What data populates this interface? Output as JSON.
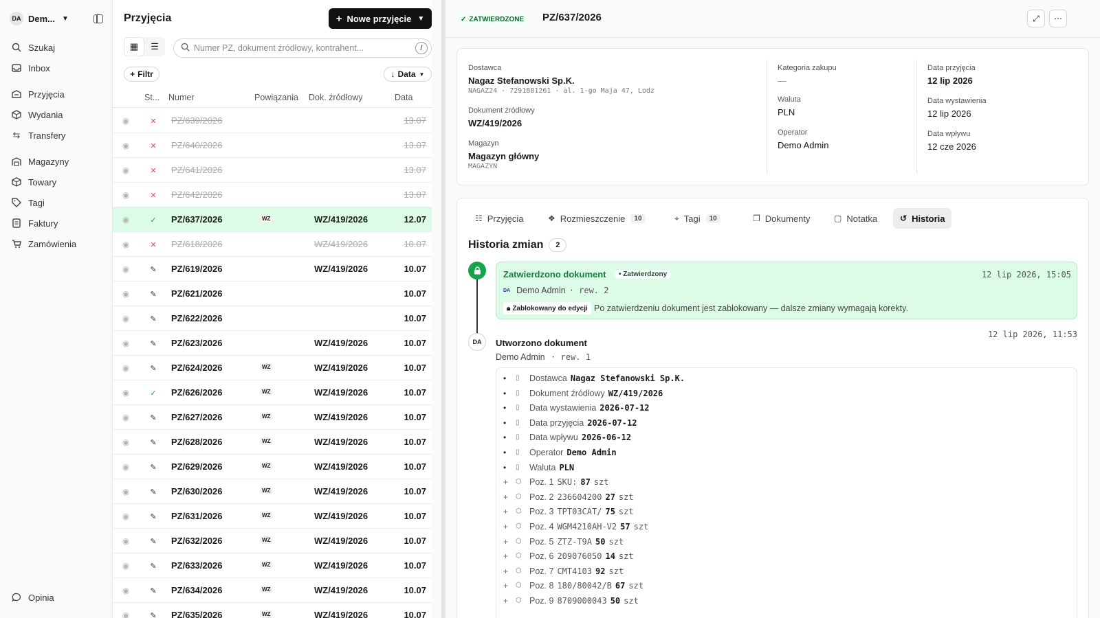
{
  "sidebar": {
    "workspace": {
      "avatar": "DA",
      "name": "Dem..."
    },
    "items": [
      {
        "label": "Szukaj",
        "icon": "search-icon"
      },
      {
        "label": "Inbox",
        "icon": "inbox-icon"
      },
      {
        "label": "Przyjęcia",
        "icon": "receipt-icon"
      },
      {
        "label": "Wydania",
        "icon": "shipment-icon"
      },
      {
        "label": "Transfery",
        "icon": "transfer-icon"
      },
      {
        "label": "Magazyny",
        "icon": "warehouse-icon"
      },
      {
        "label": "Towary",
        "icon": "box-icon"
      },
      {
        "label": "Tagi",
        "icon": "tag-icon"
      },
      {
        "label": "Faktury",
        "icon": "invoice-icon"
      },
      {
        "label": "Zamówienia",
        "icon": "cart-icon"
      }
    ],
    "feedback": "Opinia"
  },
  "list": {
    "title": "Przyjęcia",
    "new_button": "Nowe przyjęcie",
    "search_placeholder": "Numer PZ, dokument źródłowy, kontrahent...",
    "search_shortcut": "/",
    "filter_label": "Filtr",
    "sort_label": "Data",
    "columns": {
      "status": "St...",
      "number": "Numer",
      "links": "Powiązania",
      "source": "Dok. źródłowy",
      "date": "Data"
    },
    "rows": [
      {
        "status": "cancelled",
        "number": "PZ/639/2026",
        "wz": "",
        "source": "",
        "date": "13.07"
      },
      {
        "status": "cancelled",
        "number": "PZ/640/2026",
        "wz": "",
        "source": "",
        "date": "13.07"
      },
      {
        "status": "cancelled",
        "number": "PZ/641/2026",
        "wz": "",
        "source": "",
        "date": "13.07"
      },
      {
        "status": "cancelled",
        "number": "PZ/642/2026",
        "wz": "",
        "source": "",
        "date": "13.07"
      },
      {
        "status": "approved",
        "number": "PZ/637/2026",
        "wz": "WZ",
        "source": "WZ/419/2026",
        "date": "12.07",
        "selected": true
      },
      {
        "status": "cancelled",
        "number": "PZ/618/2026",
        "wz": "",
        "source": "WZ/419/2026",
        "date": "10.07"
      },
      {
        "status": "draft",
        "number": "PZ/619/2026",
        "wz": "",
        "source": "WZ/419/2026",
        "date": "10.07"
      },
      {
        "status": "draft",
        "number": "PZ/621/2026",
        "wz": "",
        "source": "",
        "date": "10.07"
      },
      {
        "status": "draft",
        "number": "PZ/622/2026",
        "wz": "",
        "source": "",
        "date": "10.07"
      },
      {
        "status": "draft",
        "number": "PZ/623/2026",
        "wz": "",
        "source": "WZ/419/2026",
        "date": "10.07"
      },
      {
        "status": "draft",
        "number": "PZ/624/2026",
        "wz": "WZ",
        "source": "WZ/419/2026",
        "date": "10.07"
      },
      {
        "status": "approved",
        "number": "PZ/626/2026",
        "wz": "WZ",
        "source": "WZ/419/2026",
        "date": "10.07"
      },
      {
        "status": "draft",
        "number": "PZ/627/2026",
        "wz": "WZ",
        "source": "WZ/419/2026",
        "date": "10.07"
      },
      {
        "status": "draft",
        "number": "PZ/628/2026",
        "wz": "WZ",
        "source": "WZ/419/2026",
        "date": "10.07"
      },
      {
        "status": "draft",
        "number": "PZ/629/2026",
        "wz": "WZ",
        "source": "WZ/419/2026",
        "date": "10.07"
      },
      {
        "status": "draft",
        "number": "PZ/630/2026",
        "wz": "WZ",
        "source": "WZ/419/2026",
        "date": "10.07"
      },
      {
        "status": "draft",
        "number": "PZ/631/2026",
        "wz": "WZ",
        "source": "WZ/419/2026",
        "date": "10.07"
      },
      {
        "status": "draft",
        "number": "PZ/632/2026",
        "wz": "WZ",
        "source": "WZ/419/2026",
        "date": "10.07"
      },
      {
        "status": "draft",
        "number": "PZ/633/2026",
        "wz": "WZ",
        "source": "WZ/419/2026",
        "date": "10.07"
      },
      {
        "status": "draft",
        "number": "PZ/634/2026",
        "wz": "WZ",
        "source": "WZ/419/2026",
        "date": "10.07"
      },
      {
        "status": "draft",
        "number": "PZ/635/2026",
        "wz": "WZ",
        "source": "WZ/419/2026",
        "date": "10.07"
      }
    ]
  },
  "detail": {
    "status": "ZATWIERDZONE",
    "number": "PZ/637/2026",
    "supplier_label": "Dostawca",
    "supplier": "Nagaz Stefanowski Sp.K.",
    "supplier_sub": "NAGAZ24 · 7291881261 · al. 1-go Maja 47, Lodz",
    "source_label": "Dokument źródłowy",
    "source": "WZ/419/2026",
    "warehouse_label": "Magazyn",
    "warehouse": "Magazyn główny",
    "warehouse_code": "MAGAZYN",
    "category_label": "Kategoria zakupu",
    "category": "—",
    "currency_label": "Waluta",
    "currency": "PLN",
    "operator_label": "Operator",
    "operator": "Demo Admin",
    "receipt_date_label": "Data przyjęcia",
    "receipt_date": "12 lip 2026",
    "issue_date_label": "Data wystawienia",
    "issue_date": "12 lip 2026",
    "inflow_date_label": "Data wpływu",
    "inflow_date": "12 cze 2026",
    "tabs": [
      {
        "label": "Przyjęcia",
        "count": ""
      },
      {
        "label": "Rozmieszczenie",
        "count": "10"
      },
      {
        "label": "Tagi",
        "count": "10"
      },
      {
        "label": "Dokumenty",
        "count": ""
      },
      {
        "label": "Notatka",
        "count": ""
      },
      {
        "label": "Historia",
        "count": ""
      }
    ],
    "history": {
      "title": "Historia zmian",
      "count": "2",
      "ev1": {
        "title": "Zatwierdzono dokument",
        "pill": "• Zatwierdzony",
        "time": "12 lip 2026, 15:05",
        "avatar": "DA",
        "user": "Demo Admin",
        "rev": "· rew. 2",
        "lock": "Zablokowany do edycji",
        "note": "Po zatwierdzeniu dokument jest zablokowany — dalsze zmiany wymagają korekty."
      },
      "ev2": {
        "avatar": "DA",
        "title": "Utworzono dokument",
        "time": "12 lip 2026, 11:53",
        "user": "Demo Admin",
        "rev": "· rew. 1"
      },
      "changes": [
        {
          "mark": "•",
          "field": "Dostawca",
          "meta": "",
          "value": "Nagaz Stefanowski Sp.K.",
          "unit": ""
        },
        {
          "mark": "•",
          "field": "Dokument źródłowy",
          "meta": "",
          "value": "WZ/419/2026",
          "unit": ""
        },
        {
          "mark": "•",
          "field": "Data wystawienia",
          "meta": "",
          "value": "2026-07-12",
          "unit": ""
        },
        {
          "mark": "•",
          "field": "Data przyjęcia",
          "meta": "",
          "value": "2026-07-12",
          "unit": ""
        },
        {
          "mark": "•",
          "field": "Data wpływu",
          "meta": "",
          "value": "2026-06-12",
          "unit": ""
        },
        {
          "mark": "•",
          "field": "Operator",
          "meta": "",
          "value": "Demo Admin",
          "unit": ""
        },
        {
          "mark": "•",
          "field": "Waluta",
          "meta": "",
          "value": "PLN",
          "unit": ""
        },
        {
          "mark": "+",
          "field": "Poz. 1",
          "meta": "SKU:",
          "value": "87",
          "unit": "szt"
        },
        {
          "mark": "+",
          "field": "Poz. 2",
          "meta": "236604200",
          "value": "27",
          "unit": "szt"
        },
        {
          "mark": "+",
          "field": "Poz. 3",
          "meta": "TPT03CAT/",
          "value": "75",
          "unit": "szt"
        },
        {
          "mark": "+",
          "field": "Poz. 4",
          "meta": "WGM4210AH-V2",
          "value": "57",
          "unit": "szt"
        },
        {
          "mark": "+",
          "field": "Poz. 5",
          "meta": "ZTZ-T9A",
          "value": "50",
          "unit": "szt"
        },
        {
          "mark": "+",
          "field": "Poz. 6",
          "meta": "209076050",
          "value": "14",
          "unit": "szt"
        },
        {
          "mark": "+",
          "field": "Poz. 7",
          "meta": "CMT4103",
          "value": "92",
          "unit": "szt"
        },
        {
          "mark": "+",
          "field": "Poz. 8",
          "meta": "180/80042/B",
          "value": "67",
          "unit": "szt"
        },
        {
          "mark": "+",
          "field": "Poz. 9",
          "meta": "8709000043",
          "value": "50",
          "unit": "szt"
        }
      ]
    }
  }
}
